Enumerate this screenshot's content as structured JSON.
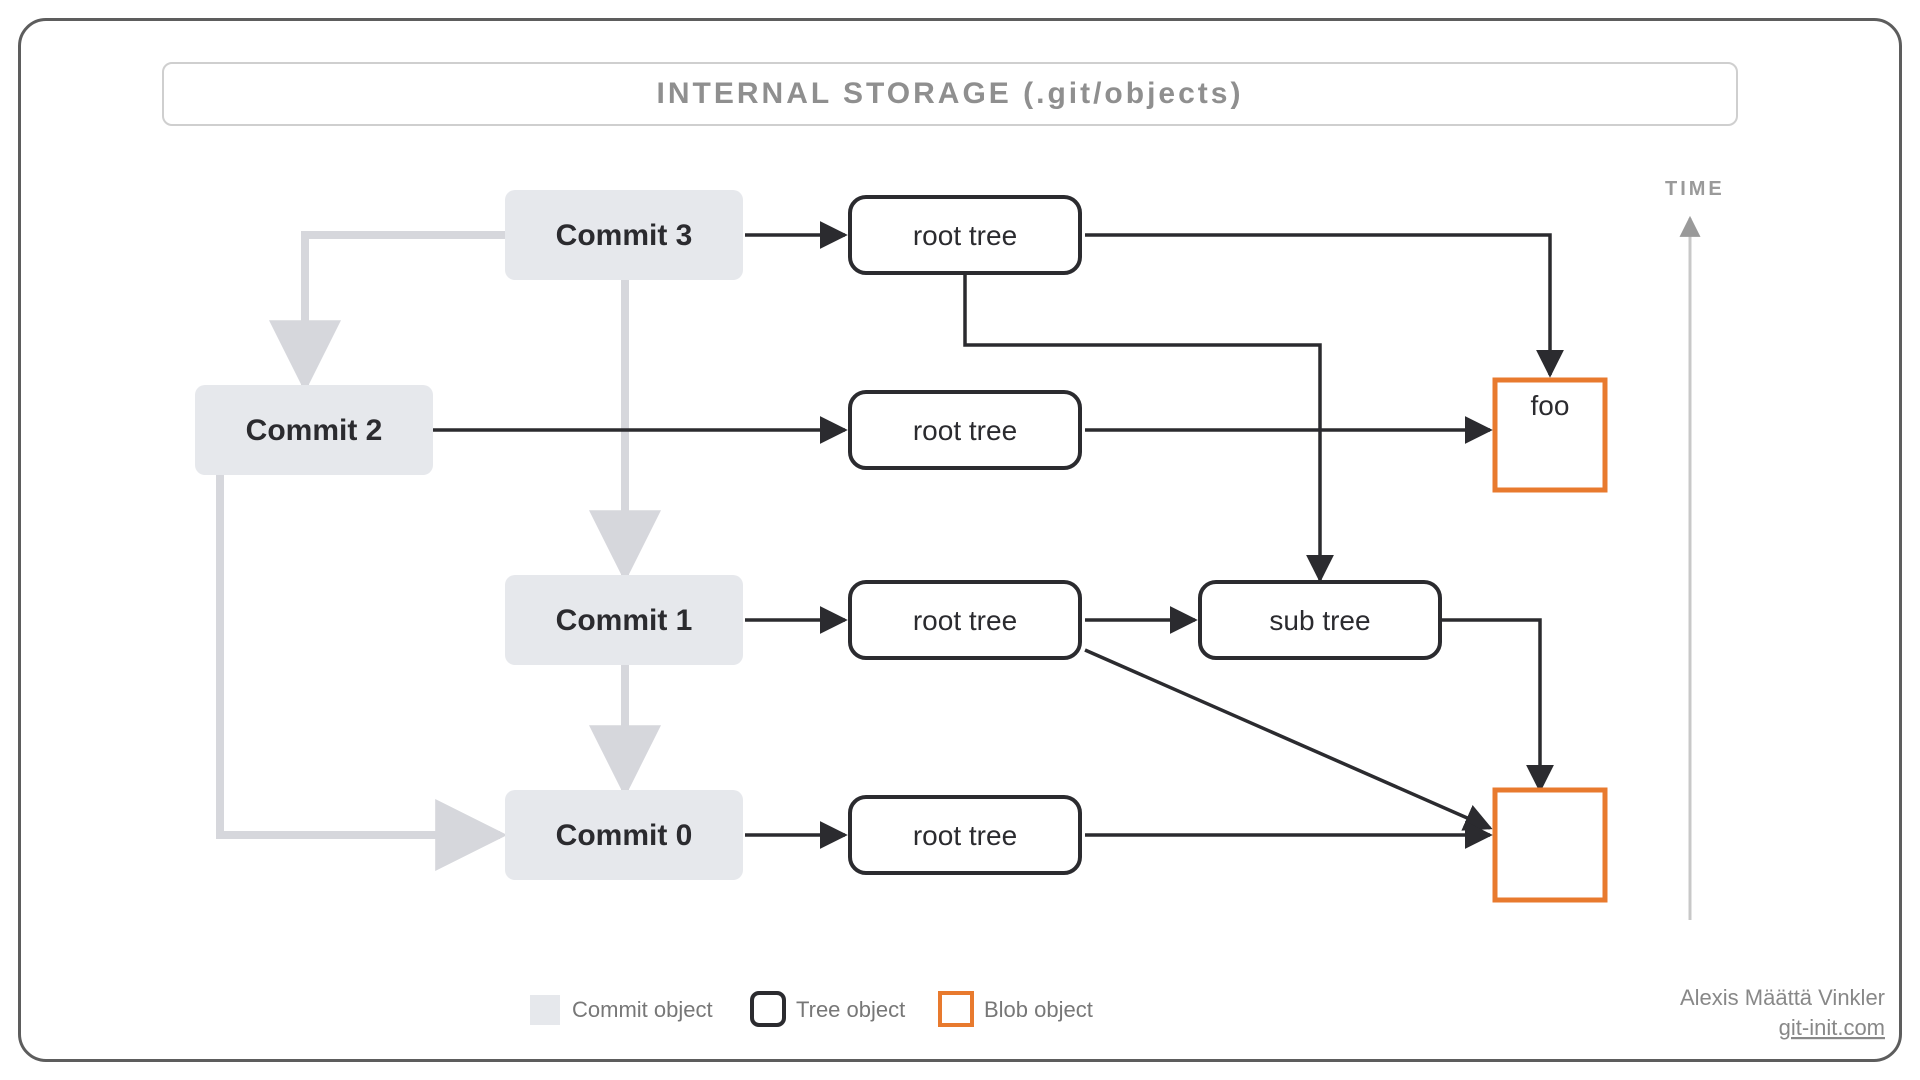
{
  "title": "INTERNAL STORAGE (.git/objects)",
  "commits": {
    "c3": "Commit 3",
    "c2": "Commit 2",
    "c1": "Commit 1",
    "c0": "Commit 0"
  },
  "trees": {
    "t3": "root tree",
    "t2": "root tree",
    "t1": "root tree",
    "t0": "root tree",
    "sub": "sub tree"
  },
  "blobs": {
    "foo": "foo",
    "anon": ""
  },
  "legend": {
    "commit": "Commit object",
    "tree": "Tree object",
    "blob": "Blob object"
  },
  "author": "Alexis Määttä Vinkler",
  "site": "git-init.com",
  "time_label": "TIME"
}
